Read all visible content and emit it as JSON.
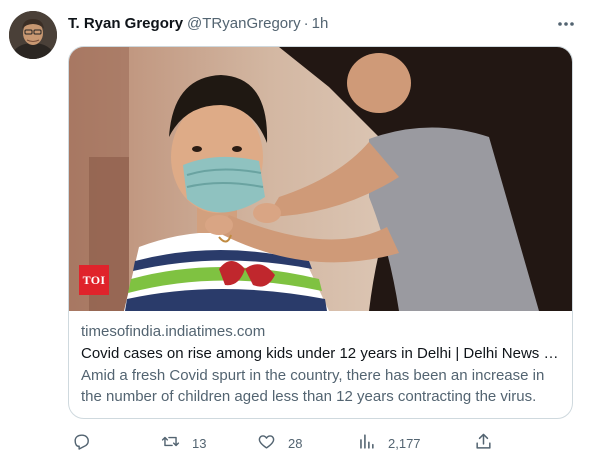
{
  "tweet": {
    "author_name": "T. Ryan Gregory",
    "handle": "@TRyanGregory",
    "separator": "·",
    "time": "1h"
  },
  "card": {
    "image_badge": "TOI",
    "domain": "timesofindia.indiatimes.com",
    "title": "Covid cases on rise among kids under 12 years in Delhi | Delhi News - ...",
    "description": "Amid a fresh Covid spurt in the country, there has been an increase in the number of children aged less than 12 years contracting the virus. While..."
  },
  "actions": {
    "reply_icon": "reply-icon",
    "retweet_icon": "retweet-icon",
    "retweet_count": "13",
    "like_icon": "heart-icon",
    "like_count": "28",
    "views_icon": "analytics-icon",
    "views_count": "2,177",
    "share_icon": "share-icon"
  },
  "colors": {
    "text_primary": "#0f1419",
    "text_secondary": "#536471",
    "border": "#cfd9de",
    "toi_red": "#e0232b"
  }
}
